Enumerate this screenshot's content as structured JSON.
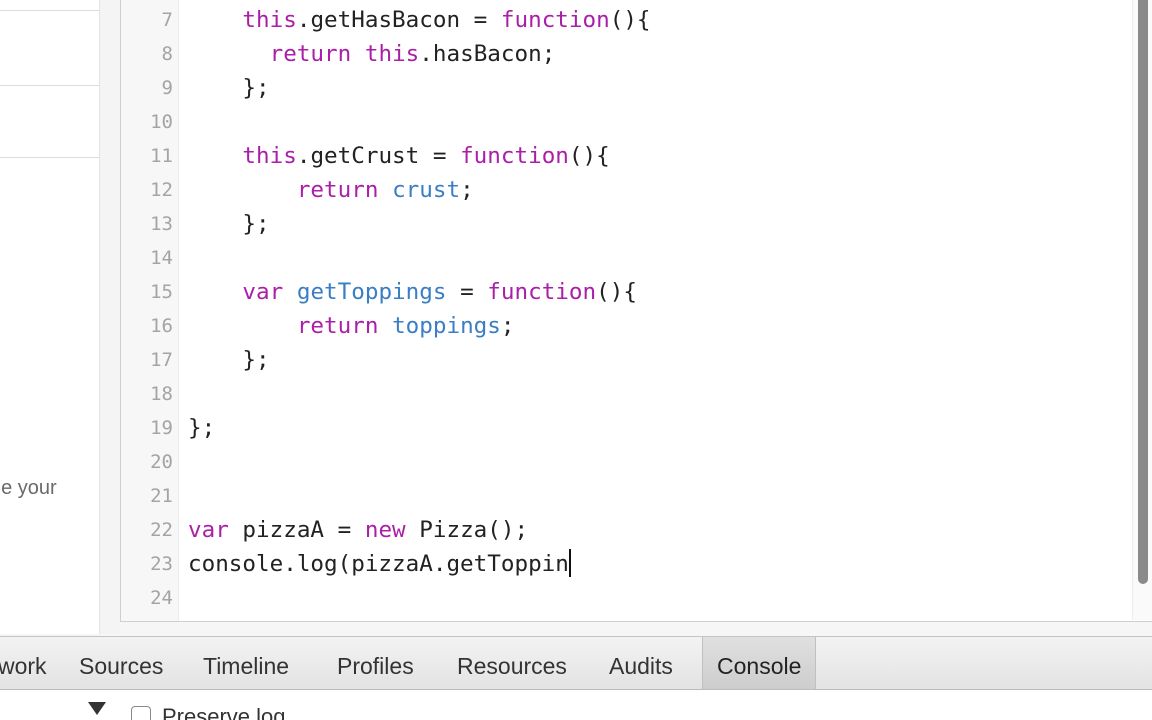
{
  "left_panel": {
    "partial_text": "ne your"
  },
  "editor": {
    "lines": [
      {
        "num": "7",
        "tokens": [
          {
            "t": "    "
          },
          {
            "t": "this",
            "c": "kw"
          },
          {
            "t": ".getHasBacon = "
          },
          {
            "t": "function",
            "c": "kw"
          },
          {
            "t": "(){"
          }
        ]
      },
      {
        "num": "8",
        "tokens": [
          {
            "t": "      "
          },
          {
            "t": "return",
            "c": "kw"
          },
          {
            "t": " "
          },
          {
            "t": "this",
            "c": "kw"
          },
          {
            "t": ".hasBacon;"
          }
        ]
      },
      {
        "num": "9",
        "tokens": [
          {
            "t": "    };"
          }
        ]
      },
      {
        "num": "10",
        "tokens": []
      },
      {
        "num": "11",
        "tokens": [
          {
            "t": "    "
          },
          {
            "t": "this",
            "c": "kw"
          },
          {
            "t": ".getCrust = "
          },
          {
            "t": "function",
            "c": "kw"
          },
          {
            "t": "(){"
          }
        ]
      },
      {
        "num": "12",
        "tokens": [
          {
            "t": "        "
          },
          {
            "t": "return",
            "c": "kw"
          },
          {
            "t": " "
          },
          {
            "t": "crust",
            "c": "id"
          },
          {
            "t": ";"
          }
        ]
      },
      {
        "num": "13",
        "tokens": [
          {
            "t": "    };"
          }
        ]
      },
      {
        "num": "14",
        "tokens": []
      },
      {
        "num": "15",
        "tokens": [
          {
            "t": "    "
          },
          {
            "t": "var",
            "c": "kw"
          },
          {
            "t": " "
          },
          {
            "t": "getToppings",
            "c": "id"
          },
          {
            "t": " = "
          },
          {
            "t": "function",
            "c": "kw"
          },
          {
            "t": "(){"
          }
        ]
      },
      {
        "num": "16",
        "tokens": [
          {
            "t": "        "
          },
          {
            "t": "return",
            "c": "kw"
          },
          {
            "t": " "
          },
          {
            "t": "toppings",
            "c": "id"
          },
          {
            "t": ";"
          }
        ]
      },
      {
        "num": "17",
        "tokens": [
          {
            "t": "    };"
          }
        ]
      },
      {
        "num": "18",
        "tokens": []
      },
      {
        "num": "19",
        "tokens": [
          {
            "t": "};"
          }
        ]
      },
      {
        "num": "20",
        "tokens": []
      },
      {
        "num": "21",
        "tokens": []
      },
      {
        "num": "22",
        "tokens": [
          {
            "t": "var",
            "c": "kw"
          },
          {
            "t": " pizzaA = "
          },
          {
            "t": "new",
            "c": "kw"
          },
          {
            "t": " Pizza();"
          }
        ]
      },
      {
        "num": "23",
        "tokens": [
          {
            "t": "console.log(pizzaA.getToppin"
          }
        ],
        "cursor": true
      },
      {
        "num": "24",
        "tokens": []
      }
    ]
  },
  "devtools": {
    "tabs": [
      {
        "label": "work",
        "active": false
      },
      {
        "label": "Sources",
        "active": false
      },
      {
        "label": "Timeline",
        "active": false
      },
      {
        "label": "Profiles",
        "active": false
      },
      {
        "label": "Resources",
        "active": false
      },
      {
        "label": "Audits",
        "active": false
      },
      {
        "label": "Console",
        "active": true
      }
    ],
    "preserve_log_label": "Preserve log"
  },
  "colors": {
    "keyword": "#aa1fa8",
    "identifier": "#3a7ec4",
    "plain": "#222222",
    "line_number": "#a4a4a4"
  }
}
